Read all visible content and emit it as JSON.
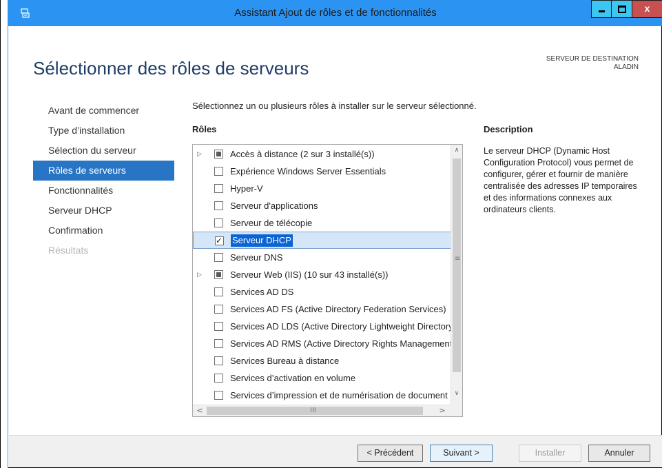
{
  "window": {
    "title": "Assistant Ajout de rôles et de fonctionnalités",
    "close_glyph": "x",
    "colors": {
      "titlebar": "#2b94f3",
      "close": "#c75050",
      "accent": "#2875c6"
    }
  },
  "header": {
    "page_title": "Sélectionner des rôles de serveurs",
    "dest_label": "SERVEUR DE DESTINATION",
    "dest_server": "ALADIN"
  },
  "nav": {
    "items": [
      {
        "label": "Avant de commencer",
        "state": "normal"
      },
      {
        "label": "Type d’installation",
        "state": "normal"
      },
      {
        "label": "Sélection du serveur",
        "state": "normal"
      },
      {
        "label": "Rôles de serveurs",
        "state": "active"
      },
      {
        "label": "Fonctionnalités",
        "state": "normal"
      },
      {
        "label": "Serveur DHCP",
        "state": "normal"
      },
      {
        "label": "Confirmation",
        "state": "normal"
      },
      {
        "label": "Résultats",
        "state": "disabled"
      }
    ]
  },
  "main": {
    "instruction": "Sélectionnez un ou plusieurs rôles à installer sur le serveur sélectionné.",
    "roles_heading": "Rôles",
    "roles": [
      {
        "label": "Accès à distance (2 sur 3 installé(s))",
        "state": "partial",
        "expandable": true
      },
      {
        "label": "Expérience Windows Server Essentials",
        "state": "unchecked",
        "expandable": false
      },
      {
        "label": "Hyper-V",
        "state": "unchecked",
        "expandable": false
      },
      {
        "label": "Serveur d'applications",
        "state": "unchecked",
        "expandable": false
      },
      {
        "label": "Serveur de télécopie",
        "state": "unchecked",
        "expandable": false
      },
      {
        "label": "Serveur DHCP",
        "state": "checked",
        "expandable": false,
        "selected": true
      },
      {
        "label": "Serveur DNS",
        "state": "unchecked",
        "expandable": false
      },
      {
        "label": "Serveur Web (IIS) (10 sur 43 installé(s))",
        "state": "partial",
        "expandable": true
      },
      {
        "label": "Services AD DS",
        "state": "unchecked",
        "expandable": false
      },
      {
        "label": "Services AD FS (Active Directory Federation Services)",
        "state": "unchecked",
        "expandable": false
      },
      {
        "label": "Services AD LDS (Active Directory Lightweight Directory Services)",
        "state": "unchecked",
        "expandable": false
      },
      {
        "label": "Services AD RMS (Active Directory Rights Management Services)",
        "state": "unchecked",
        "expandable": false
      },
      {
        "label": "Services Bureau à distance",
        "state": "unchecked",
        "expandable": false
      },
      {
        "label": "Services d’activation en volume",
        "state": "unchecked",
        "expandable": false
      },
      {
        "label": "Services d’impression et de numérisation de document",
        "state": "unchecked",
        "expandable": false
      }
    ],
    "description_heading": "Description",
    "description_text": "Le serveur DHCP (Dynamic Host Configuration Protocol) vous permet de configurer, gérer et fournir de manière centralisée des adresses IP temporaires et des informations connexes aux ordinateurs clients."
  },
  "scroll": {
    "up": "∧",
    "down": "∨",
    "left": "<",
    "right": ">",
    "vgrip": "≡",
    "hgrip": "III"
  },
  "footer": {
    "prev": "< Précédent",
    "next": "Suivant >",
    "install": "Installer",
    "cancel": "Annuler"
  }
}
